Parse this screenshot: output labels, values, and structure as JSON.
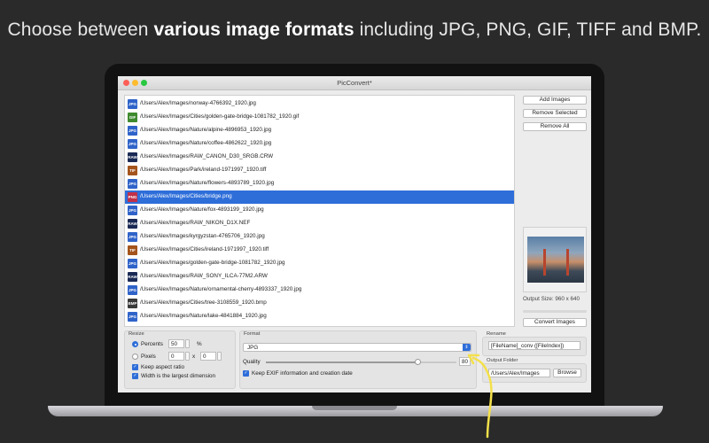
{
  "headline": {
    "prefix": "Choose between ",
    "bold": "various image formats",
    "suffix": " including JPG, PNG, GIF, TIFF and BMP."
  },
  "window": {
    "title": "PicConvert*"
  },
  "format_colors": {
    "JPG": "#2f63c9",
    "GIF": "#3f8a2f",
    "RAW": "#1a2a55",
    "TIF": "#a4541c",
    "PNG": "#c03048",
    "BMP": "#3a3a3a"
  },
  "files": [
    {
      "format": "JPG",
      "path": "/Users/Alex/Images/norway-4766392_1920.jpg",
      "selected": false
    },
    {
      "format": "GIF",
      "path": "/Users/Alex/Images/Cities/golden-gate-bridge-1081782_1920.gif",
      "selected": false
    },
    {
      "format": "JPG",
      "path": "/Users/Alex/Images/Nature/alpine-4896953_1920.jpg",
      "selected": false
    },
    {
      "format": "JPG",
      "path": "/Users/Alex/Images/Nature/coffee-4862622_1920.jpg",
      "selected": false
    },
    {
      "format": "RAW",
      "path": "/Users/Alex/Images/RAW_CANON_D30_SRGB.CRW",
      "selected": false
    },
    {
      "format": "TIF",
      "path": "/Users/Alex/Images/Park/ireland-1971997_1920.tiff",
      "selected": false
    },
    {
      "format": "JPG",
      "path": "/Users/Alex/Images/Nature/flowers-4893789_1920.jpg",
      "selected": false
    },
    {
      "format": "PNG",
      "path": "/Users/Alex/Images/Cities/bridge.png",
      "selected": true
    },
    {
      "format": "JPG",
      "path": "/Users/Alex/Images/Nature/fox-4893199_1920.jpg",
      "selected": false
    },
    {
      "format": "RAW",
      "path": "/Users/Alex/Images/RAW_NIKON_D1X.NEF",
      "selected": false
    },
    {
      "format": "JPG",
      "path": "/Users/Alex/Images/kyrgyzstan-4765706_1920.jpg",
      "selected": false
    },
    {
      "format": "TIF",
      "path": "/Users/Alex/Images/Cities/ireland-1971997_1920.tiff",
      "selected": false
    },
    {
      "format": "JPG",
      "path": "/Users/Alex/Images/golden-gate-bridge-1081782_1920.jpg",
      "selected": false
    },
    {
      "format": "RAW",
      "path": "/Users/Alex/Images/RAW_SONY_ILCA-77M2.ARW",
      "selected": false
    },
    {
      "format": "JPG",
      "path": "/Users/Alex/Images/Nature/ornamental-cherry-4893337_1920.jpg",
      "selected": false
    },
    {
      "format": "BMP",
      "path": "/Users/Alex/Images/Cities/tree-3108559_1920.bmp",
      "selected": false
    },
    {
      "format": "JPG",
      "path": "/Users/Alex/Images/Nature/lake-4841884_1920.jpg",
      "selected": false
    }
  ],
  "actions": {
    "add": "Add Images",
    "remove_selected": "Remove Selected",
    "remove_all": "Remove All",
    "convert": "Convert Images"
  },
  "preview": {
    "output_size": "Output Size: 960 x 640"
  },
  "resize": {
    "label": "Resize",
    "percents_label": "Percents",
    "percents_value": "50",
    "percent_sign": "%",
    "pixels_label": "Pixels",
    "pixels_w": "0",
    "x_sep": "x",
    "pixels_h": "0",
    "keep_aspect": "Keep aspect ratio",
    "width_largest": "Width is the largest dimension"
  },
  "format": {
    "label": "Format",
    "selected": "JPG",
    "quality_label": "Quality",
    "quality_value": "80",
    "quality_fraction": 0.8,
    "keep_exif": "Keep EXIF information and creation date"
  },
  "rename": {
    "label": "Rename",
    "pattern": "[FileName]_conv ([FileIndex])"
  },
  "output": {
    "label": "Output Folder",
    "path": "/Users/Alex/Images",
    "browse": "Browse"
  },
  "accent_color": "#2e6ed9",
  "annotation_color": "#f4e04a"
}
